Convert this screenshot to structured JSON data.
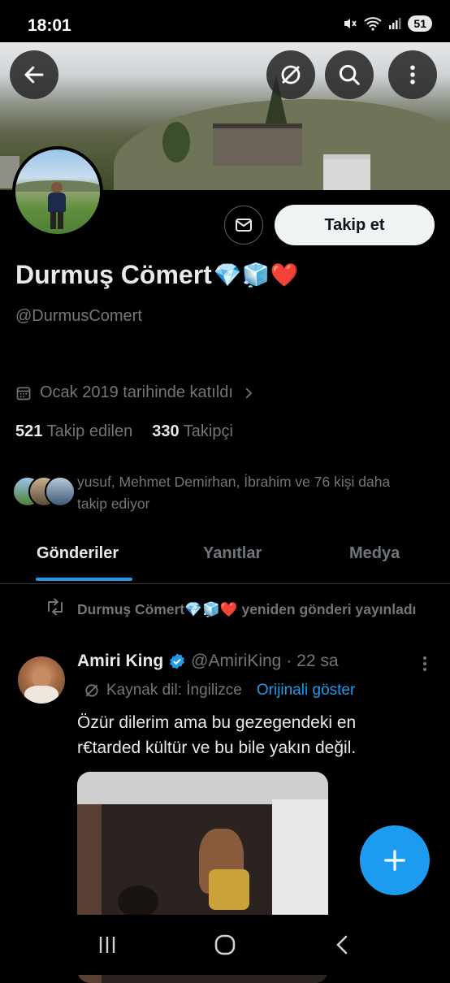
{
  "status_bar": {
    "time": "18:01",
    "battery": "51"
  },
  "profile": {
    "name": "Durmuş Cömert",
    "name_emojis": "💎🧊❤️",
    "handle": "@DurmusComert",
    "joined": "Ocak 2019 tarihinde katıldı",
    "following_count": "521",
    "following_label": "Takip edilen",
    "followers_count": "330",
    "followers_label": "Takipçi",
    "followed_by": "yusuf, Mehmet Demirhan, İbrahim ve 76 kişi daha takip ediyor",
    "follow_button": "Takip et"
  },
  "tabs": [
    "Gönderiler",
    "Yanıtlar",
    "Medya"
  ],
  "post": {
    "repost_line": "Durmuş Cömert💎🧊❤️ yeniden gönderi yayınladı",
    "author": "Amiri King",
    "author_handle": "@AmiriKing",
    "time": "· 22 sa",
    "translation_source": "Kaynak dil: İngilizce",
    "translation_link": "Orijinali göster",
    "text": "Özür dilerim ama bu gezegendeki en r€tarded kültür ve bu bile yakın değil."
  },
  "colors": {
    "accent": "#1d9bf0",
    "background": "#000000",
    "muted": "#71767b"
  },
  "icons": [
    "back-arrow-icon",
    "grok-icon",
    "search-icon",
    "more-vertical-icon",
    "mail-icon",
    "calendar-icon",
    "chevron-right-icon",
    "repost-icon",
    "verified-badge-icon",
    "translate-icon",
    "plus-icon"
  ]
}
